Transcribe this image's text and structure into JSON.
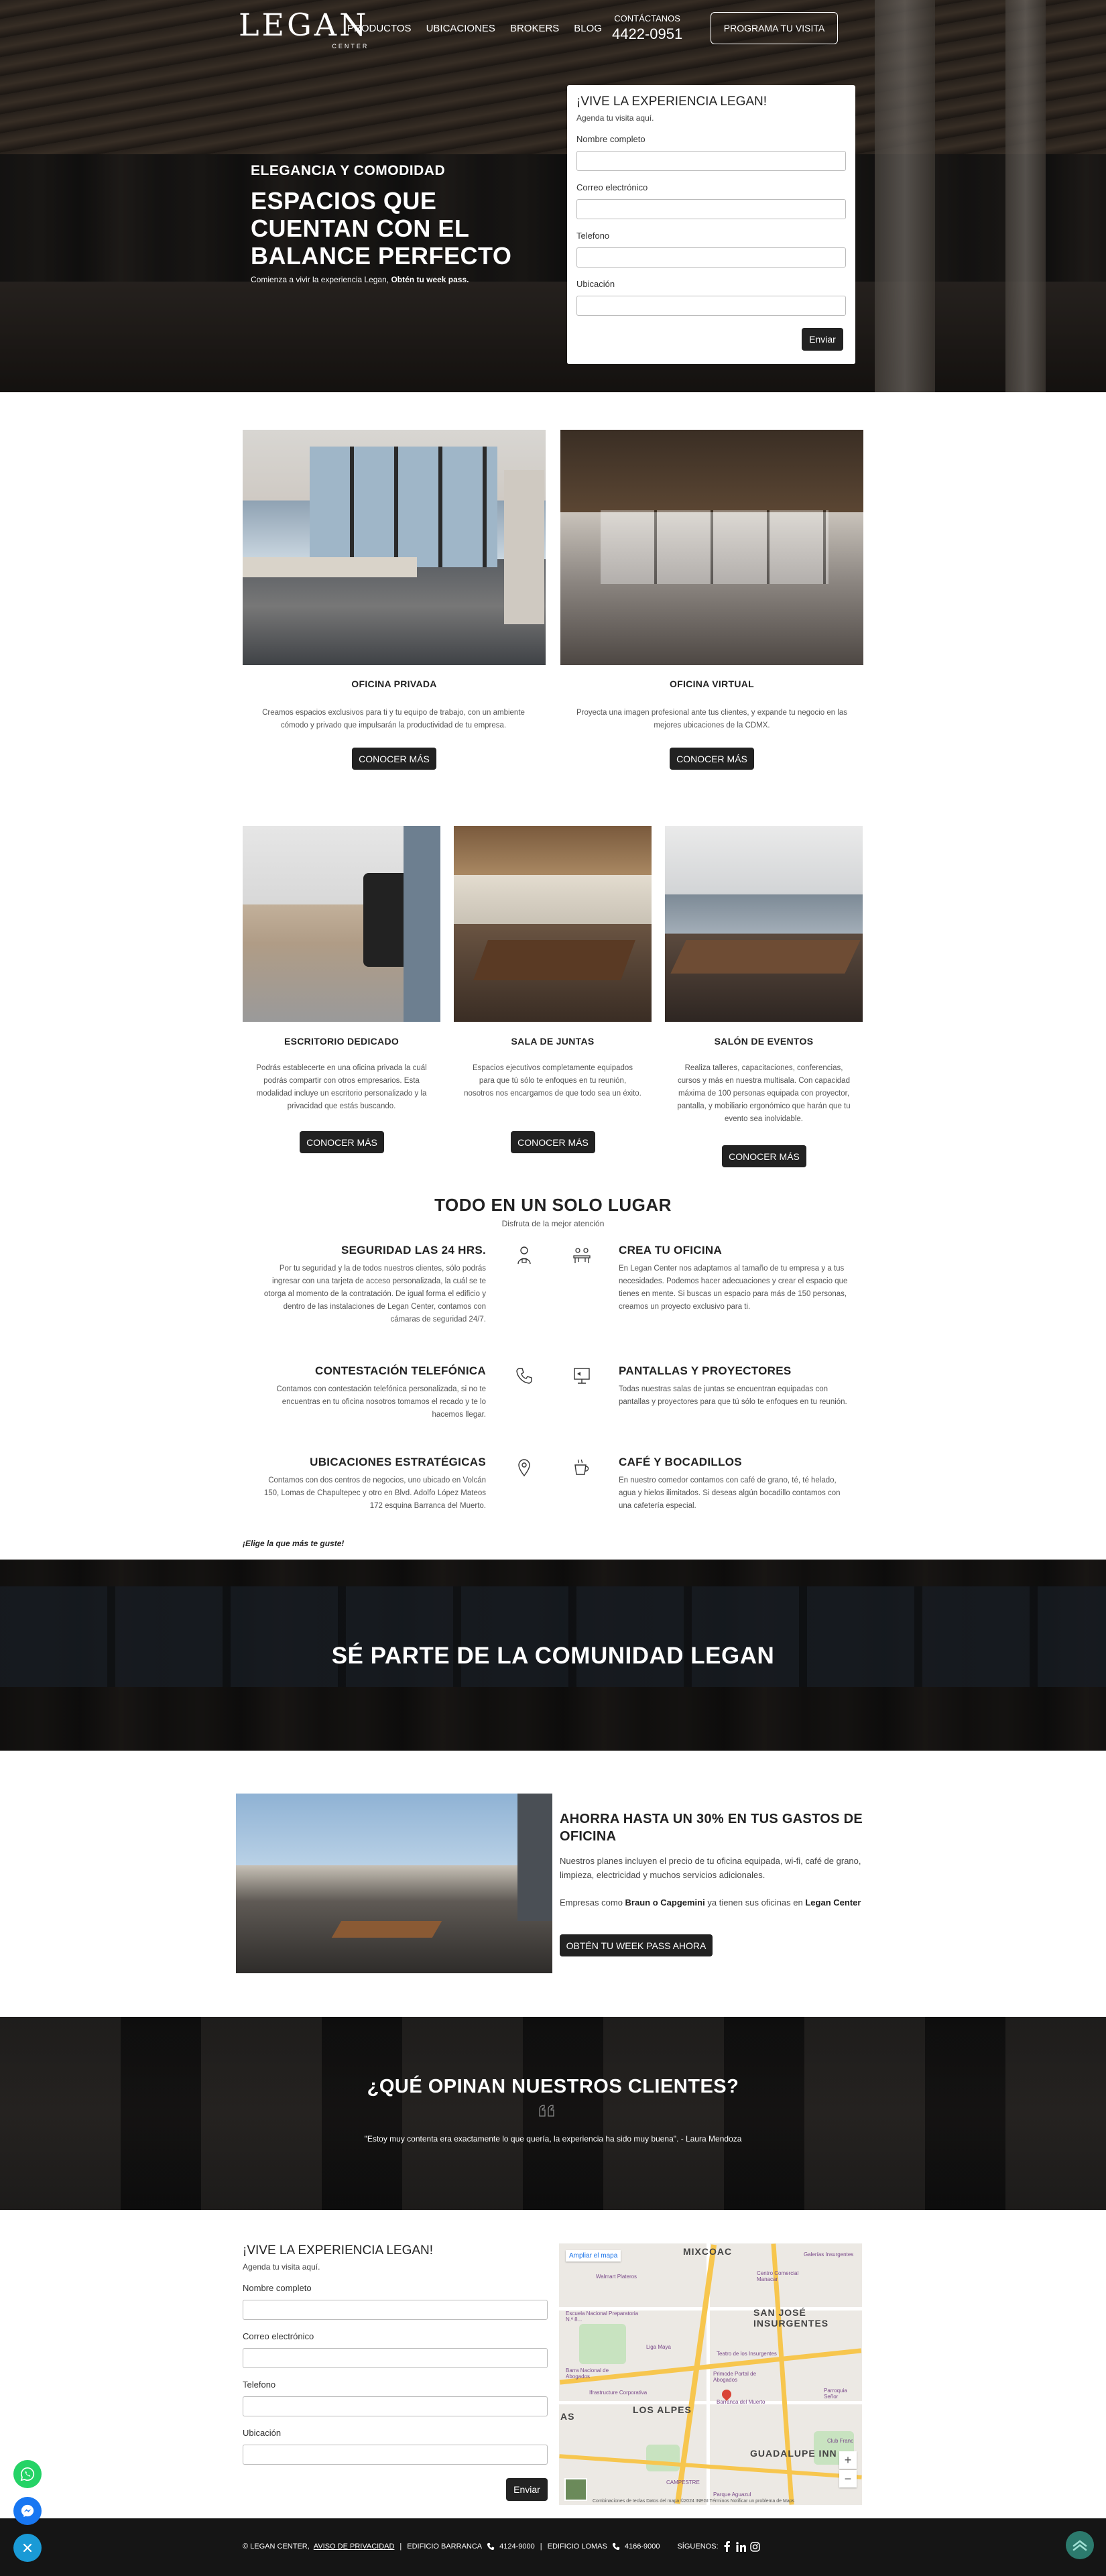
{
  "nav": {
    "logo": "LEGAN",
    "logo_sub": "CENTER",
    "links": [
      "PRODUCTOS",
      "UBICACIONES",
      "BROKERS",
      "BLOG"
    ],
    "contact_label": "CONTÁCTANOS",
    "contact_number": "4422-0951",
    "cta": "PROGRAMA TU VISITA"
  },
  "hero": {
    "kicker": "ELEGANCIA Y COMODIDAD",
    "title": "ESPACIOS QUE CUENTAN CON EL BALANCE PERFECTO",
    "text": "Comienza a vivir la experiencia Legan,",
    "text_bold": "Obtén tu week pass."
  },
  "form": {
    "title": "¡VIVE LA EXPERIENCIA LEGAN!",
    "subtitle": "Agenda tu visita aquí.",
    "fields": [
      "Nombre completo",
      "Correo electrónico",
      "Telefono",
      "Ubicación"
    ],
    "submit": "Enviar"
  },
  "products_row1": [
    {
      "title": "OFICINA PRIVADA",
      "desc": "Creamos espacios exclusivos para ti y tu equipo de trabajo, con un ambiente cómodo y privado que impulsarán la productividad de tu empresa.",
      "button": "CONOCER MÁS"
    },
    {
      "title": "OFICINA VIRTUAL",
      "desc": "Proyecta una imagen profesional ante tus clientes, y expande tu negocio en las mejores ubicaciones de la CDMX.",
      "button": "CONOCER MÁS"
    }
  ],
  "products_row2": [
    {
      "title": "ESCRITORIO DEDICADO",
      "desc": "Podrás establecerte en una oficina privada la cuál podrás compartir con otros empresarios. Esta modalidad incluye un escritorio personalizado y la privacidad que estás buscando.",
      "button": "CONOCER MÁS"
    },
    {
      "title": "SALA DE JUNTAS",
      "desc": "Espacios ejecutivos completamente equipados para que tú sólo te enfoques en tu reunión, nosotros nos encargamos de que todo sea un éxito.",
      "button": "CONOCER MÁS"
    },
    {
      "title": "SALÓN DE EVENTOS",
      "desc": "Realiza talleres, capacitaciones, conferencias, cursos y más en nuestra multisala. Con capacidad máxima de 100 personas equipada con proyector, pantalla, y mobiliario ergonómico que harán que tu evento sea inolvidable.",
      "button": "CONOCER MÁS"
    }
  ],
  "features": {
    "title": "TODO EN UN SOLO LUGAR",
    "subtitle": "Disfruta de la mejor atención",
    "left": [
      {
        "title": "SEGURIDAD LAS 24 HRS.",
        "text": "Por tu seguridad y la de todos nuestros clientes, sólo podrás ingresar con una tarjeta de acceso personalizada, la cuál se te otorga al momento de la contratación. De igual forma el edificio y dentro de las instalaciones de Legan Center, contamos con cámaras de seguridad 24/7.",
        "icon": "security-guard-icon"
      },
      {
        "title": "CONTESTACIÓN TELEFÓNICA",
        "text": "Contamos con contestación telefónica personalizada, si no te encuentras en tu oficina nosotros tomamos el recado y te lo hacemos llegar.",
        "icon": "phone-icon"
      },
      {
        "title": "UBICACIONES ESTRATÉGICAS",
        "text": "Contamos con dos centros de negocios, uno ubicado en Volcán 150, Lomas de Chapultepec y otro en Blvd. Adolfo López Mateos 172 esquina Barranca del Muerto.",
        "icon": "location-pin-icon"
      }
    ],
    "right": [
      {
        "title": "CREA TU OFICINA",
        "text": "En Legan Center nos adaptamos al tamaño de tu empresa y a tus necesidades. Podemos hacer adecuaciones y crear el espacio que tienes en mente. Si buscas un espacio para más de 150 personas, creamos un proyecto exclusivo para ti.",
        "icon": "office-team-icon"
      },
      {
        "title": "PANTALLAS Y PROYECTORES",
        "text": "Todas nuestras salas de juntas se encuentran equipadas con pantallas y proyectores para que tú sólo te enfoques en tu reunión.",
        "icon": "projector-screen-icon"
      },
      {
        "title": "CAFÉ Y BOCADILLOS",
        "text": "En nuestro comedor contamos con café de grano, té, té helado, agua y hielos ilimitados. Si deseas algún bocadillo contamos con una cafetería especial.",
        "icon": "coffee-cup-icon"
      }
    ],
    "tagline": "¡Elige la que más te guste!"
  },
  "banner": {
    "title": "SÉ PARTE DE LA COMUNIDAD LEGAN"
  },
  "promo": {
    "title": "AHORRA HASTA UN 30% EN TUS GASTOS DE OFICINA",
    "p1": "Nuestros planes incluyen el precio de tu oficina equipada, wi-fi, café de grano, limpieza, electricidad y muchos servicios adicionales.",
    "p2_a": "Empresas como",
    "p2_b": "Braun o Capgemini",
    "p2_c": "ya tienen sus oficinas en",
    "p2_d": "Legan Center",
    "button": "OBTÉN TU WEEK PASS AHORA"
  },
  "testimonials": {
    "title": "¿QUÉ OPINAN NUESTROS CLIENTES?",
    "quote": "\"Estoy muy contenta era exactamente lo que quería, la experiencia ha sido muy buena\". - Laura Mendoza"
  },
  "form2": {
    "title": "¡VIVE LA EXPERIENCIA LEGAN!",
    "subtitle": "Agenda tu visita aquí.",
    "fields": [
      "Nombre completo",
      "Correo electrónico",
      "Telefono",
      "Ubicación"
    ],
    "submit": "Enviar"
  },
  "map": {
    "expand": "Ampliar el mapa",
    "areas": [
      "MIXCOAC",
      "SAN JOSÉ INSURGENTES",
      "LOS ALPES",
      "GUADALUPE INN",
      "AS"
    ],
    "places": [
      "Walmart Plateros",
      "Escuela Nacional Preparatoria N.º 8...",
      "Centro Comercial Manacar",
      "Galerías Insurgentes",
      "Liga Maya",
      "Barra Nacional de Abogados",
      "Ifrastructure Corporativa",
      "Primode Portal de Abogados",
      "Barranca del Muerto",
      "Parroquia Señor",
      "Club Franc",
      "Teatro de los Insurgentes",
      "CAMPESTRE",
      "Parque Aguazul"
    ],
    "attribution": "Combinaciones de teclas   Datos del mapa ©2024 INEGI   Términos   Notificar un problema de Maps",
    "zoom_in": "+",
    "zoom_out": "−"
  },
  "footer": {
    "copyright": "© LEGAN CENTER,",
    "privacy": "AVISO DE PRIVACIDAD",
    "building1": "EDIFICIO BARRANCA",
    "phone1": "4124-9000",
    "building2": "EDIFICIO LOMAS",
    "phone2": "4166-9000",
    "follow": "SÍGUENOS:"
  },
  "colors": {
    "dark": "#222222",
    "whatsapp": "#25D366",
    "messenger": "#1877F2",
    "close": "#1a9ad6",
    "top": "#2c7a6d"
  }
}
